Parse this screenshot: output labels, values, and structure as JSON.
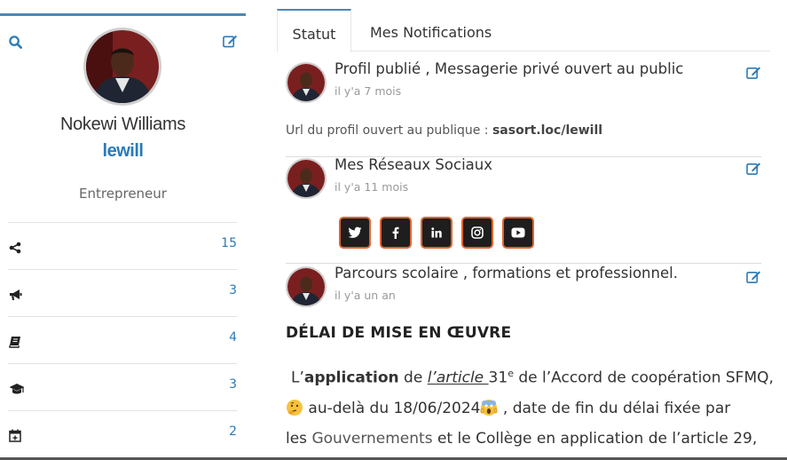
{
  "profile": {
    "name": "Nokewi Williams",
    "username": "lewill",
    "job": "Entrepreneur",
    "stats": [
      {
        "icon": "share-icon",
        "count": "15"
      },
      {
        "icon": "megaphone-icon",
        "count": "3"
      },
      {
        "icon": "book-icon",
        "count": "4"
      },
      {
        "icon": "graduation-cap-icon",
        "count": "3"
      },
      {
        "icon": "calendar-plus-icon",
        "count": "2"
      }
    ]
  },
  "tabs": [
    "Statut",
    "Mes Notifications"
  ],
  "posts": [
    {
      "title": "Profil publié , Messagerie privé ouvert au public",
      "time": "il y'a 7 mois"
    },
    {
      "title": "Mes Réseaux Sociaux",
      "time": "il y'a 11 mois"
    },
    {
      "title": "Parcours scolaire , formations et professionnel.",
      "time": "il y'a un an"
    }
  ],
  "url_line": {
    "label": "Url du profil ouvert au publique :",
    "url": "sasort.loc/lewill"
  },
  "socials": [
    "twitter-icon",
    "facebook-icon",
    "linkedin-icon",
    "instagram-icon",
    "youtube-icon"
  ],
  "article": {
    "heading": "DÉLAI DE MISE EN ŒUVRE",
    "l1_a": "L’",
    "l1_b": "application",
    "l1_c": " de ",
    "l1_d": "l’article ",
    "l1_e": "31",
    "l1_sup": "e",
    "l1_f": " de l’Accord de coopération SFMQ,",
    "l2_a": " au-delà du 18/06/2024",
    "l2_b": " , date de fin du délai fixée par",
    "l3_a": "les ",
    "l3_b": "Gouvernements",
    "l3_c": " et le Collège en application de l’article 29,"
  },
  "colors": {
    "accent": "#2a7ab8",
    "social_border": "#e2652e"
  }
}
